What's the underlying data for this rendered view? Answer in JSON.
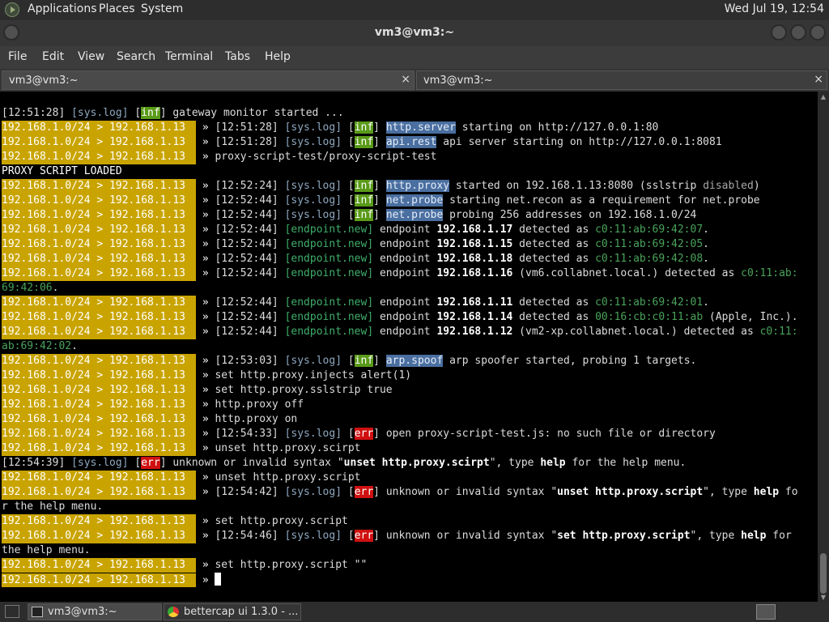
{
  "top_panel": {
    "menus": [
      "Applications",
      "Places",
      "System"
    ],
    "clock": "Wed Jul 19, 12:54"
  },
  "window": {
    "title": "vm3@vm3:~"
  },
  "menubar": [
    "File",
    "Edit",
    "View",
    "Search",
    "Terminal",
    "Tabs",
    "Help"
  ],
  "tabs": [
    {
      "label": "vm3@vm3:~",
      "close": "×"
    },
    {
      "label": "vm3@vm3:~",
      "close": "×"
    }
  ],
  "terminal": {
    "prefix_left": "192.168.1.0/24",
    "prefix_arrow": ">",
    "prefix_right": "192.168.1.13",
    "chevron": "»",
    "lines": [
      [
        [
          "",
          "[12:51:28] "
        ],
        [
          "sys",
          "[sys.log]"
        ],
        [
          "",
          " ["
        ],
        [
          "inf",
          "inf"
        ],
        [
          "",
          "] gateway monitor started ..."
        ]
      ],
      [
        [
          "P",
          ""
        ],
        [
          "",
          "[12:51:28] "
        ],
        [
          "sys",
          "[sys.log]"
        ],
        [
          "",
          " ["
        ],
        [
          "inf",
          "inf"
        ],
        [
          "",
          "] "
        ],
        [
          "mod",
          "http.server"
        ],
        [
          "",
          " starting on http://127.0.0.1:80"
        ]
      ],
      [
        [
          "P",
          ""
        ],
        [
          "",
          "[12:51:28] "
        ],
        [
          "sys",
          "[sys.log]"
        ],
        [
          "",
          " ["
        ],
        [
          "inf",
          "inf"
        ],
        [
          "",
          "] "
        ],
        [
          "mod",
          "api.rest"
        ],
        [
          "",
          " api server starting on http://127.0.0.1:8081"
        ]
      ],
      [
        [
          "P",
          ""
        ],
        [
          "",
          "proxy-script-test/proxy-script-test"
        ]
      ],
      [
        [
          "cw",
          "PROXY SCRIPT LOADED"
        ]
      ],
      [
        [
          "P",
          ""
        ],
        [
          "",
          "[12:52:24] "
        ],
        [
          "sys",
          "[sys.log]"
        ],
        [
          "",
          " ["
        ],
        [
          "inf",
          "inf"
        ],
        [
          "",
          "] "
        ],
        [
          "mod",
          "http.proxy"
        ],
        [
          "",
          " started on 192.168.1.13:8080 (sslstrip "
        ],
        [
          "grey",
          "disabled"
        ],
        [
          "",
          ")"
        ]
      ],
      [
        [
          "P",
          ""
        ],
        [
          "",
          "[12:52:44] "
        ],
        [
          "sys",
          "[sys.log]"
        ],
        [
          "",
          " ["
        ],
        [
          "inf",
          "inf"
        ],
        [
          "",
          "] "
        ],
        [
          "mod",
          "net.probe"
        ],
        [
          "",
          " starting net.recon as a requirement for net.probe"
        ]
      ],
      [
        [
          "P",
          ""
        ],
        [
          "",
          "[12:52:44] "
        ],
        [
          "sys",
          "[sys.log]"
        ],
        [
          "",
          " ["
        ],
        [
          "inf",
          "inf"
        ],
        [
          "",
          "] "
        ],
        [
          "mod",
          "net.probe"
        ],
        [
          "",
          " probing 256 addresses on 192.168.1.0/24"
        ]
      ],
      [
        [
          "P",
          ""
        ],
        [
          "",
          "[12:52:44] "
        ],
        [
          "ep",
          "[endpoint.new]"
        ],
        [
          "",
          " endpoint "
        ],
        [
          "b",
          "192.168.1.17"
        ],
        [
          "",
          " detected as "
        ],
        [
          "mac",
          "c0:11:ab:69:42:07"
        ],
        [
          "",
          "."
        ]
      ],
      [
        [
          "P",
          ""
        ],
        [
          "",
          "[12:52:44] "
        ],
        [
          "ep",
          "[endpoint.new]"
        ],
        [
          "",
          " endpoint "
        ],
        [
          "b",
          "192.168.1.15"
        ],
        [
          "",
          " detected as "
        ],
        [
          "mac",
          "c0:11:ab:69:42:05"
        ],
        [
          "",
          "."
        ]
      ],
      [
        [
          "P",
          ""
        ],
        [
          "",
          "[12:52:44] "
        ],
        [
          "ep",
          "[endpoint.new]"
        ],
        [
          "",
          " endpoint "
        ],
        [
          "b",
          "192.168.1.18"
        ],
        [
          "",
          " detected as "
        ],
        [
          "mac",
          "c0:11:ab:69:42:08"
        ],
        [
          "",
          "."
        ]
      ],
      [
        [
          "P",
          ""
        ],
        [
          "",
          "[12:52:44] "
        ],
        [
          "ep",
          "[endpoint.new]"
        ],
        [
          "",
          " endpoint "
        ],
        [
          "b",
          "192.168.1.16"
        ],
        [
          "",
          " (vm6.collabnet.local.) detected as "
        ],
        [
          "mac",
          "c0:11:ab:"
        ]
      ],
      [
        [
          "mac",
          "69:42:06"
        ],
        [
          "",
          "."
        ]
      ],
      [
        [
          "P",
          ""
        ],
        [
          "",
          "[12:52:44] "
        ],
        [
          "ep",
          "[endpoint.new]"
        ],
        [
          "",
          " endpoint "
        ],
        [
          "b",
          "192.168.1.11"
        ],
        [
          "",
          " detected as "
        ],
        [
          "mac",
          "c0:11:ab:69:42:01"
        ],
        [
          "",
          "."
        ]
      ],
      [
        [
          "P",
          ""
        ],
        [
          "",
          "[12:52:44] "
        ],
        [
          "ep",
          "[endpoint.new]"
        ],
        [
          "",
          " endpoint "
        ],
        [
          "b",
          "192.168.1.14"
        ],
        [
          "",
          " detected as "
        ],
        [
          "mac",
          "00:16:cb:c0:11:ab"
        ],
        [
          "",
          " (Apple, Inc.)."
        ]
      ],
      [
        [
          "P",
          ""
        ],
        [
          "",
          "[12:52:44] "
        ],
        [
          "ep",
          "[endpoint.new]"
        ],
        [
          "",
          " endpoint "
        ],
        [
          "b",
          "192.168.1.12"
        ],
        [
          "",
          " (vm2-xp.collabnet.local.) detected as "
        ],
        [
          "mac",
          "c0:11:"
        ]
      ],
      [
        [
          "mac",
          "ab:69:42:02"
        ],
        [
          "",
          "."
        ]
      ],
      [
        [
          "P",
          ""
        ],
        [
          "",
          "[12:53:03] "
        ],
        [
          "sys",
          "[sys.log]"
        ],
        [
          "",
          " ["
        ],
        [
          "inf",
          "inf"
        ],
        [
          "",
          "] "
        ],
        [
          "mod",
          "arp.spoof"
        ],
        [
          "",
          " arp spoofer started, probing 1 targets."
        ]
      ],
      [
        [
          "P",
          ""
        ],
        [
          "",
          "set http.proxy.injects alert(1)"
        ]
      ],
      [
        [
          "P",
          ""
        ],
        [
          "",
          "set http.proxy.sslstrip true"
        ]
      ],
      [
        [
          "P",
          ""
        ],
        [
          "",
          "http.proxy off"
        ]
      ],
      [
        [
          "P",
          ""
        ],
        [
          "",
          "http.proxy on"
        ]
      ],
      [
        [
          "P",
          ""
        ],
        [
          "",
          "[12:54:33] "
        ],
        [
          "sys",
          "[sys.log]"
        ],
        [
          "",
          " ["
        ],
        [
          "err",
          "err"
        ],
        [
          "",
          "] open proxy-script-test.js: no such file or directory"
        ]
      ],
      [
        [
          "P",
          ""
        ],
        [
          "",
          "unset http.proxy.scirpt"
        ]
      ],
      [
        [
          "",
          "[12:54:39] "
        ],
        [
          "sys",
          "[sys.log]"
        ],
        [
          "",
          " ["
        ],
        [
          "err",
          "err"
        ],
        [
          "",
          "] unknown or invalid syntax \""
        ],
        [
          "b",
          "unset http.proxy.scirpt"
        ],
        [
          "",
          "\", type "
        ],
        [
          "b",
          "help"
        ],
        [
          "",
          " for the help menu."
        ]
      ],
      [
        [
          "P",
          ""
        ],
        [
          "",
          "unset http.proxy.script"
        ]
      ],
      [
        [
          "P",
          ""
        ],
        [
          "",
          "[12:54:42] "
        ],
        [
          "sys",
          "[sys.log]"
        ],
        [
          "",
          " ["
        ],
        [
          "err",
          "err"
        ],
        [
          "",
          "] unknown or invalid syntax \""
        ],
        [
          "b",
          "unset http.proxy.script"
        ],
        [
          "",
          "\", type "
        ],
        [
          "b",
          "help"
        ],
        [
          "",
          " fo"
        ]
      ],
      [
        [
          "",
          "r the help menu."
        ]
      ],
      [
        [
          "P",
          ""
        ],
        [
          "",
          "set http.proxy.script"
        ]
      ],
      [
        [
          "P",
          ""
        ],
        [
          "",
          "[12:54:46] "
        ],
        [
          "sys",
          "[sys.log]"
        ],
        [
          "",
          " ["
        ],
        [
          "err",
          "err"
        ],
        [
          "",
          "] unknown or invalid syntax \""
        ],
        [
          "b",
          "set http.proxy.script"
        ],
        [
          "",
          "\", type "
        ],
        [
          "b",
          "help"
        ],
        [
          "",
          " for"
        ]
      ],
      [
        [
          "",
          "the help menu."
        ]
      ],
      [
        [
          "P",
          ""
        ],
        [
          "",
          "set http.proxy.script \"\""
        ]
      ],
      [
        [
          "P",
          ""
        ],
        [
          "C",
          ""
        ]
      ]
    ]
  },
  "taskbar": {
    "tasks": [
      {
        "label": "vm3@vm3:~",
        "icon": "terminal-icon"
      },
      {
        "label": "bettercap ui 1.3.0 - ...",
        "icon": "chrome-icon"
      }
    ]
  }
}
